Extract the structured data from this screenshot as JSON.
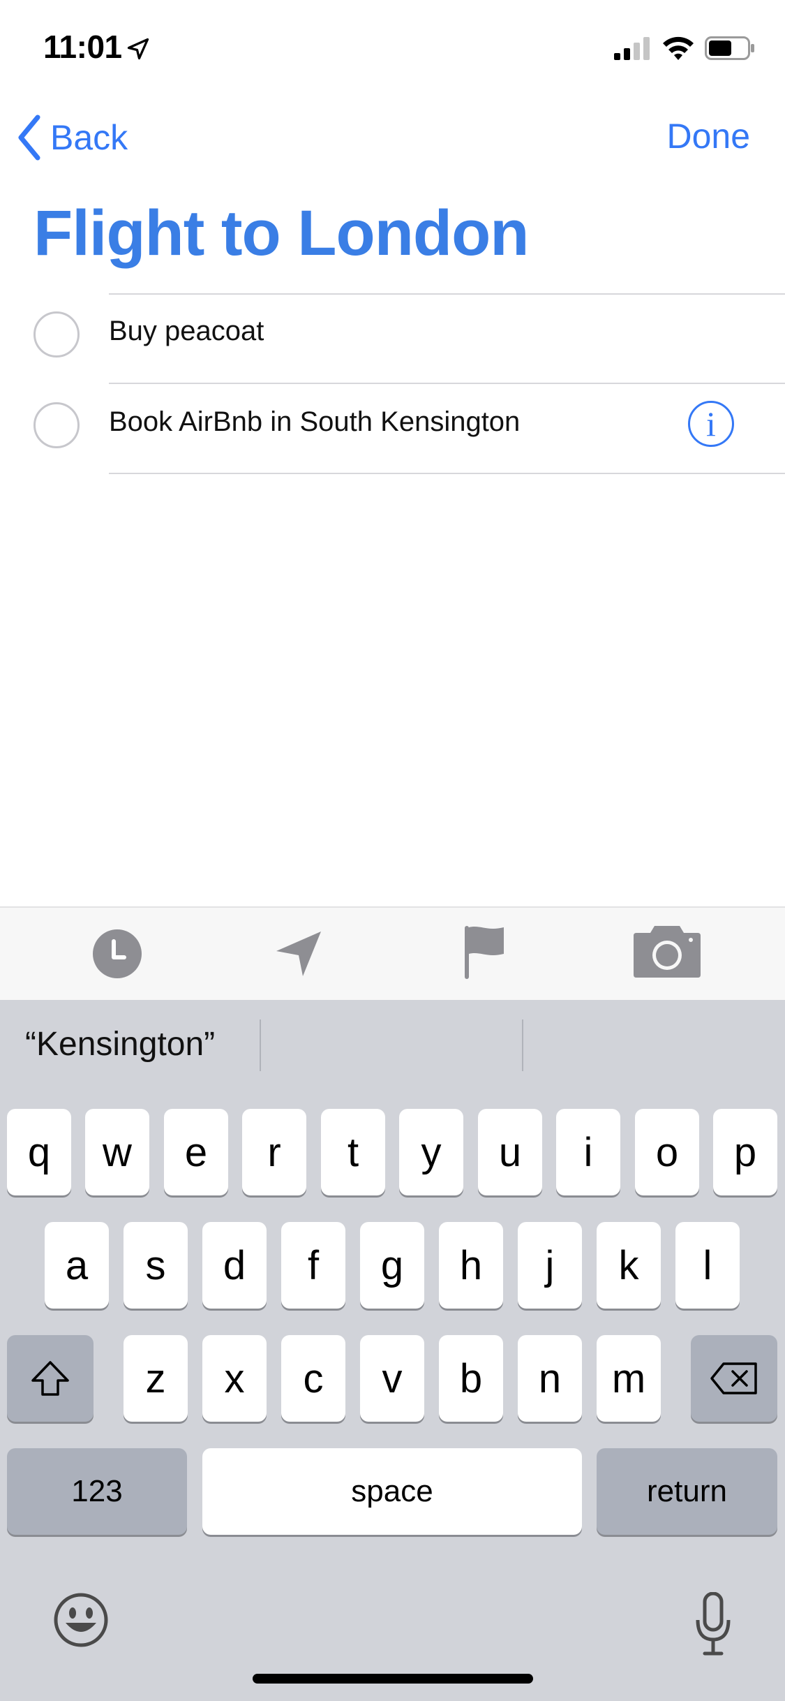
{
  "status": {
    "time": "11:01"
  },
  "nav": {
    "back_label": "Back",
    "done_label": "Done"
  },
  "list": {
    "title": "Flight to London",
    "items": [
      {
        "text": "Buy peacoat"
      },
      {
        "text": "Book AirBnb in South Kensington"
      }
    ],
    "info_glyph": "i"
  },
  "toolbar": {
    "icons": [
      "clock-icon",
      "location-arrow-icon",
      "flag-icon",
      "camera-icon"
    ]
  },
  "keyboard": {
    "prediction": "“Kensington”",
    "row1": [
      "q",
      "w",
      "e",
      "r",
      "t",
      "y",
      "u",
      "i",
      "o",
      "p"
    ],
    "row2": [
      "a",
      "s",
      "d",
      "f",
      "g",
      "h",
      "j",
      "k",
      "l"
    ],
    "row3": [
      "z",
      "x",
      "c",
      "v",
      "b",
      "n",
      "m"
    ],
    "numbers_label": "123",
    "space_label": "space",
    "return_label": "return",
    "icons": [
      "shift-icon",
      "delete-icon",
      "emoji-icon",
      "microphone-icon"
    ]
  },
  "colors": {
    "accent": "#3478f6",
    "title": "#3a7ee5",
    "keyboard_bg": "#d1d3d9",
    "fn_key": "#abb0bb"
  }
}
